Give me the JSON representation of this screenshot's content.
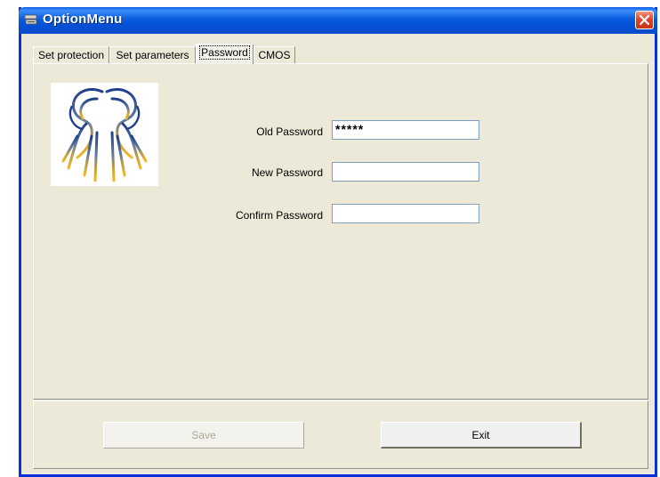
{
  "window": {
    "title": "OptionMenu"
  },
  "tabs": [
    {
      "label": "Set protection"
    },
    {
      "label": "Set parameters"
    },
    {
      "label": "Password",
      "active": true
    },
    {
      "label": "CMOS"
    }
  ],
  "form": {
    "old_password": {
      "label": "Old Password",
      "value": "*****"
    },
    "new_password": {
      "label": "New Password",
      "value": ""
    },
    "confirm_password": {
      "label": "Confirm Password",
      "value": ""
    }
  },
  "buttons": {
    "save": {
      "label": "Save",
      "enabled": false
    },
    "exit": {
      "label": "Exit",
      "enabled": true
    }
  },
  "colors": {
    "title_bar": "#0a5bdf",
    "dialog_bg": "#ece9d8",
    "close_button": "#e0452c"
  }
}
